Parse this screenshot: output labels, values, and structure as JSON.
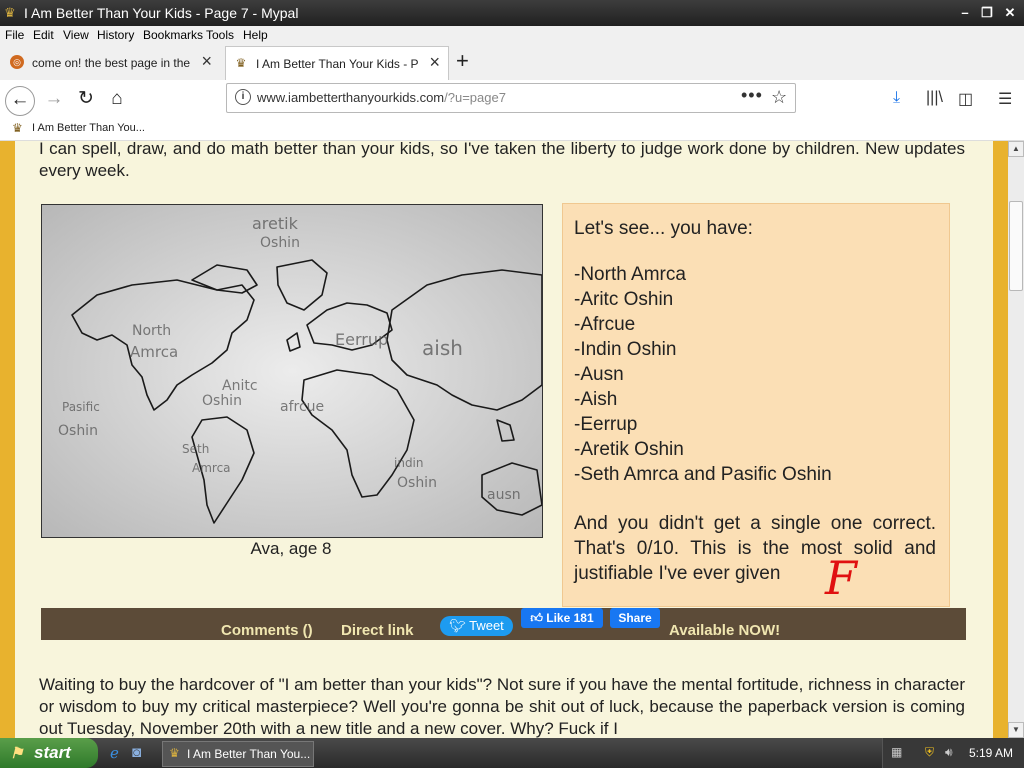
{
  "window": {
    "title": "I Am Better Than Your Kids - Page 7 - Mypal"
  },
  "menu": [
    "File",
    "Edit",
    "View",
    "History",
    "Bookmarks",
    "Tools",
    "Help"
  ],
  "tabs": [
    {
      "label": "come on! the best page in the uni",
      "active": false
    },
    {
      "label": "I Am Better Than Your Kids - Page",
      "active": true
    }
  ],
  "nav": {
    "url_host": "www.iambetterthanyourkids.com",
    "url_path": "/?u=page7"
  },
  "bookmarks": [
    {
      "label": "I Am Better Than You..."
    }
  ],
  "content": {
    "intro": "I can spell, draw, and do math better than your kids, so I've taken the liberty to judge work done by children. New updates every week.",
    "map_labels": [
      "aretik",
      "Oshin",
      "North",
      "Amrca",
      "Eerrup",
      "aish",
      "Anitc",
      "Oshin",
      "afrcue",
      "Pasific",
      "Oshin",
      "Seth",
      "Amrca",
      "indin",
      "Oshin",
      "ausn"
    ],
    "caption": "Ava, age 8",
    "comment": {
      "intro": "Let's see... you have:",
      "list": [
        "-North Amrca",
        "-Aritc Oshin",
        "-Afrcue",
        "-Indin Oshin",
        "-Ausn",
        "-Aish",
        "-Eerrup",
        "-Aretik Oshin",
        "-Seth Amrca and Pasific Oshin"
      ],
      "verdict": "And you didn't get a single one correct. That's 0/10. This is the most solid and justifiable      I've ever given",
      "grade": "F"
    },
    "share": {
      "comments": "Comments ()",
      "direct_link": "Direct link",
      "tweet": "Tweet",
      "like": "Like 181",
      "share": "Share",
      "available": "Available NOW!"
    },
    "para2": "Waiting to buy the hardcover of \"I am better than your kids\"? Not sure if you have the mental fortitude, richness in character or wisdom to buy my critical masterpiece? Well you're gonna be shit out of luck, because the paperback version is coming out Tuesday, November 20th with a new title and a new cover. Why? Fuck if I"
  },
  "taskbar": {
    "start": "start",
    "item": "I Am Better Than You...",
    "clock": "5:19 AM"
  }
}
